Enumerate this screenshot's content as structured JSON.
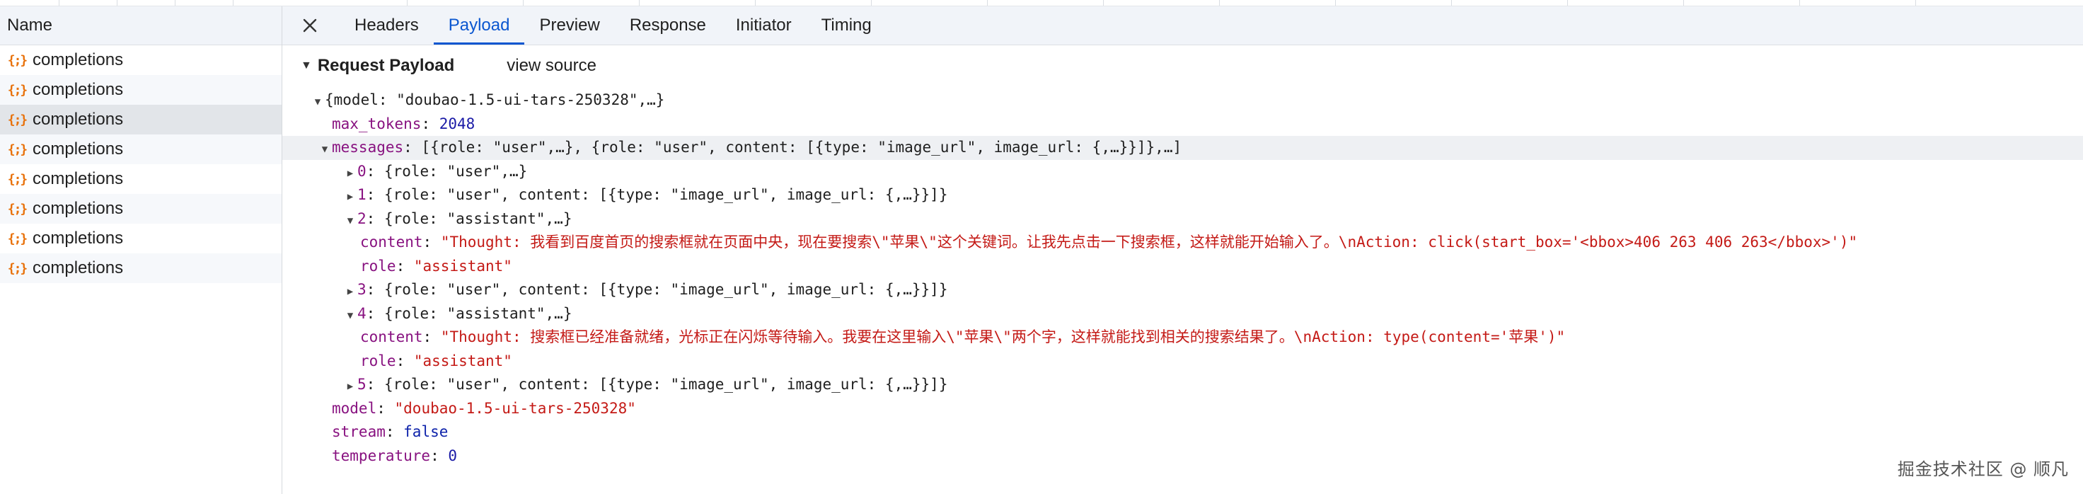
{
  "left_panel": {
    "column_header": "Name",
    "requests": [
      {
        "name": "completions",
        "icon": "fetch-icon"
      },
      {
        "name": "completions",
        "icon": "fetch-icon"
      },
      {
        "name": "completions",
        "icon": "fetch-icon"
      },
      {
        "name": "completions",
        "icon": "fetch-icon"
      },
      {
        "name": "completions",
        "icon": "fetch-icon"
      },
      {
        "name": "completions",
        "icon": "fetch-icon"
      },
      {
        "name": "completions",
        "icon": "fetch-icon"
      },
      {
        "name": "completions",
        "icon": "fetch-icon"
      }
    ],
    "selected_index": 2
  },
  "tabs": {
    "close": "✕",
    "items": [
      "Headers",
      "Payload",
      "Preview",
      "Response",
      "Initiator",
      "Timing"
    ],
    "active": "Payload"
  },
  "payload": {
    "section_title": "Request Payload",
    "view_source": "view source",
    "root_summary": "{model: \"doubao-1.5-ui-tars-250328\",…}",
    "max_tokens_key": "max_tokens",
    "max_tokens_value": "2048",
    "messages_key": "messages",
    "messages_summary": "[{role: \"user\",…}, {role: \"user\", content: [{type: \"image_url\", image_url: {,…}}]},…]",
    "msg0_key": "0",
    "msg0_summary": "{role: \"user\",…}",
    "msg1_key": "1",
    "msg1_summary": "{role: \"user\", content: [{type: \"image_url\", image_url: {,…}}]}",
    "msg2_key": "2",
    "msg2_summary": "{role: \"assistant\",…}",
    "msg2_content_key": "content",
    "msg2_content_value": "\"Thought: 我看到百度首页的搜索框就在页面中央，现在要搜索\\\"苹果\\\"这个关键词。让我先点击一下搜索框，这样就能开始输入了。\\nAction: click(start_box='<bbox>406 263 406 263</bbox>')\"",
    "msg2_role_key": "role",
    "msg2_role_value": "\"assistant\"",
    "msg3_key": "3",
    "msg3_summary": "{role: \"user\", content: [{type: \"image_url\", image_url: {,…}}]}",
    "msg4_key": "4",
    "msg4_summary": "{role: \"assistant\",…}",
    "msg4_content_key": "content",
    "msg4_content_value": "\"Thought: 搜索框已经准备就绪，光标正在闪烁等待输入。我要在这里输入\\\"苹果\\\"两个字，这样就能找到相关的搜索结果了。\\nAction: type(content='苹果')\"",
    "msg4_role_key": "role",
    "msg4_role_value": "\"assistant\"",
    "msg5_key": "5",
    "msg5_summary": "{role: \"user\", content: [{type: \"image_url\", image_url: {,…}}]}",
    "model_key": "model",
    "model_value": "\"doubao-1.5-ui-tars-250328\"",
    "stream_key": "stream",
    "stream_value": "false",
    "temperature_key": "temperature",
    "temperature_value": "0"
  },
  "watermark": "掘金技术社区 @ 顺凡",
  "colors": {
    "accent": "#0b57d0",
    "key": "#881280",
    "string": "#c41a16",
    "number": "#1a1aa6",
    "fetch_icon": "#e8710a"
  }
}
